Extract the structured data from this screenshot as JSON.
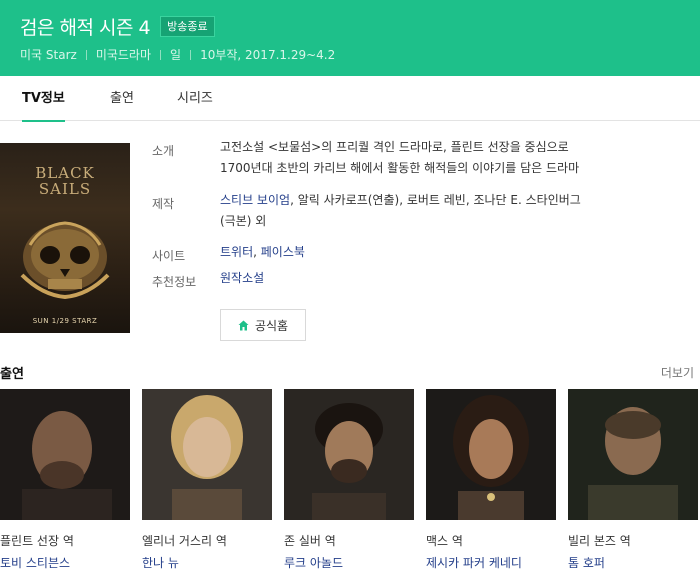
{
  "header": {
    "title": "검은 해적 시즌 4",
    "badge": "방송종료",
    "meta": [
      "미국 Starz",
      "미국드라마",
      "일",
      "10부작, 2017.1.29~4.2"
    ],
    "bg_color": "#1ec08a"
  },
  "tabs": [
    "TV정보",
    "출연",
    "시리즈"
  ],
  "poster": {
    "title_line1": "BLACK",
    "title_line2": "SAILS",
    "date": "SUN 1/29 STARZ"
  },
  "info": {
    "intro_label": "소개",
    "intro_line1": "고전소설 <보물섬>의 프리퀄 격인 드라마로, 플린트 선장을 중심으로",
    "intro_line2": "1700년대 초반의 카리브 해에서 활동한 해적들의 이야기를 담은 드라마",
    "production_label": "제작",
    "production_link1": "스티브 보이엄",
    "production_text1": ", 알릭 사카로프(연출), 로버트 레빈, 조나단 E. 스타인버그",
    "production_text2": "(극본) 외",
    "site_label": "사이트",
    "site_link1": "트위터",
    "site_sep": ", ",
    "site_link2": "페이스북",
    "recommend_label": "추천정보",
    "recommend_value": "원작소설",
    "home_button": "공식홈"
  },
  "cast_section": {
    "title": "출연",
    "more": "더보기",
    "members": [
      {
        "role": "플린트 선장 역",
        "name": "토비 스티븐스"
      },
      {
        "role": "엘리너 거스리 역",
        "name": "한나 뉴"
      },
      {
        "role": "존 실버 역",
        "name": "루크 아놀드"
      },
      {
        "role": "맥스 역",
        "name": "제시카 파커 케네디"
      },
      {
        "role": "빌리 본즈 역",
        "name": "톰 호퍼"
      }
    ]
  }
}
